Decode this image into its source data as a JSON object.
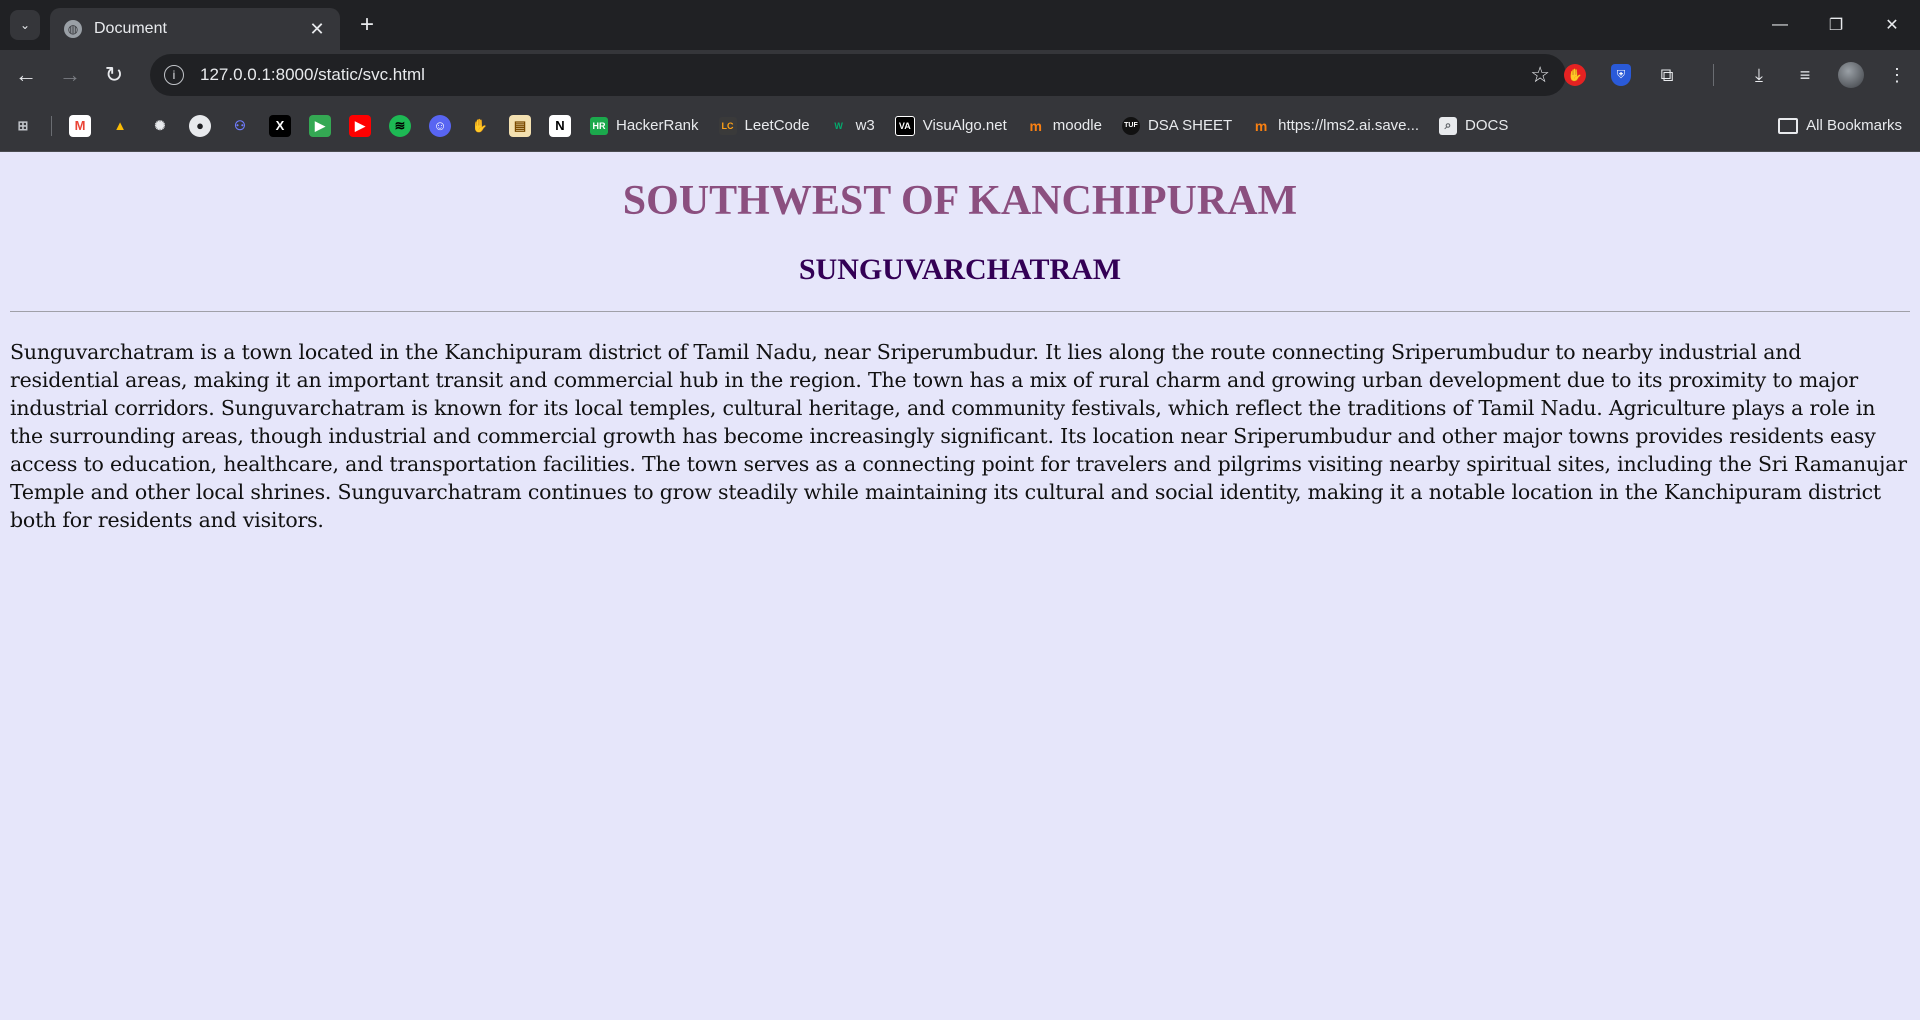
{
  "browser": {
    "tab_title": "Document",
    "new_tab_label": "+",
    "url": "127.0.0.1:8000/static/svc.html",
    "window_controls": {
      "minimize": "—",
      "restore": "❐",
      "close": "✕"
    }
  },
  "bookmarks": {
    "items": [
      {
        "label": "HackerRank",
        "icon": "HR",
        "color": "#1ba94c"
      },
      {
        "label": "LeetCode",
        "icon": "LC",
        "color": "#ffa116"
      },
      {
        "label": "w3",
        "icon": "W",
        "color": "#04aa6d"
      },
      {
        "label": "VisuAlgo.net",
        "icon": "VA",
        "color": "#000000"
      },
      {
        "label": "moodle",
        "icon": "m",
        "color": "#f98012"
      },
      {
        "label": "DSA SHEET",
        "icon": "TUF",
        "color": "#111111"
      },
      {
        "label": "https://lms2.ai.save...",
        "icon": "m",
        "color": "#f98012"
      },
      {
        "label": "DOCS",
        "icon": "⌕",
        "color": "#5f6368"
      }
    ],
    "all_label": "All Bookmarks"
  },
  "page": {
    "heading": "SOUTHWEST OF KANCHIPURAM",
    "subheading": "SUNGUVARCHATRAM",
    "paragraph": "Sunguvarchatram is a town located in the Kanchipuram district of Tamil Nadu, near Sriperumbudur. It lies along the route connecting Sriperumbudur to nearby industrial and residential areas, making it an important transit and commercial hub in the region. The town has a mix of rural charm and growing urban development due to its proximity to major industrial corridors. Sunguvarchatram is known for its local temples, cultural heritage, and community festivals, which reflect the traditions of Tamil Nadu. Agriculture plays a role in the surrounding areas, though industrial and commercial growth has become increasingly significant. Its location near Sriperumbudur and other major towns provides residents easy access to education, healthcare, and transportation facilities. The town serves as a connecting point for travelers and pilgrims visiting nearby spiritual sites, including the Sri Ramanujar Temple and other local shrines. Sunguvarchatram continues to grow steadily while maintaining its cultural and social identity, making it a notable location in the Kanchipuram district both for residents and visitors."
  },
  "colors": {
    "page_background": "#e6e6fa",
    "heading": "#8b4f7f",
    "subheading": "#330055"
  }
}
